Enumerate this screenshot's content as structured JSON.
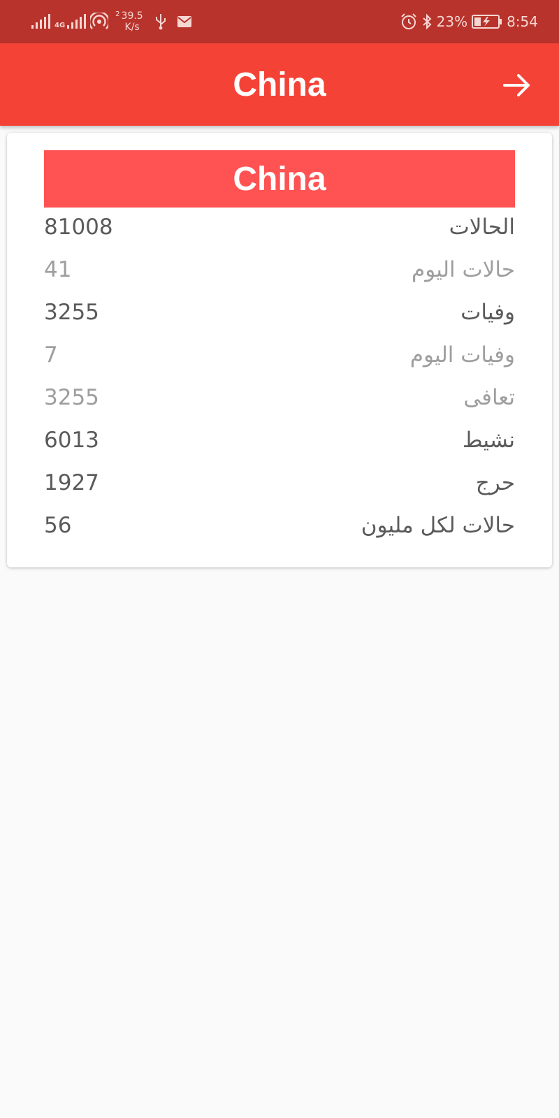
{
  "status_bar": {
    "speed_sup": "2",
    "speed_value": "39.5",
    "speed_unit": "K/s",
    "network_label": "4G",
    "battery": "23%",
    "time": "8:54"
  },
  "app_bar": {
    "title": "China",
    "forward_icon": "arrow-right-icon"
  },
  "card": {
    "title": "China",
    "stats": [
      {
        "label": "الحالات",
        "value": "81008",
        "tone": "dark"
      },
      {
        "label": "حالات اليوم",
        "value": "41",
        "tone": "light"
      },
      {
        "label": "وفيات",
        "value": "3255",
        "tone": "dark"
      },
      {
        "label": "وفيات اليوم",
        "value": "7",
        "tone": "light"
      },
      {
        "label": "تعافى",
        "value": "3255",
        "tone": "light"
      },
      {
        "label": "نشيط",
        "value": "6013",
        "tone": "dark"
      },
      {
        "label": "حرج",
        "value": "1927",
        "tone": "dark"
      },
      {
        "label": "حالات لكل مليون",
        "value": "56",
        "tone": "dark"
      }
    ]
  },
  "colors": {
    "status_bar": "#b8332b",
    "app_bar": "#f44336",
    "card_header": "#ff5252",
    "dark_text": "#5a5a5a",
    "light_text": "#9e9e9e"
  }
}
